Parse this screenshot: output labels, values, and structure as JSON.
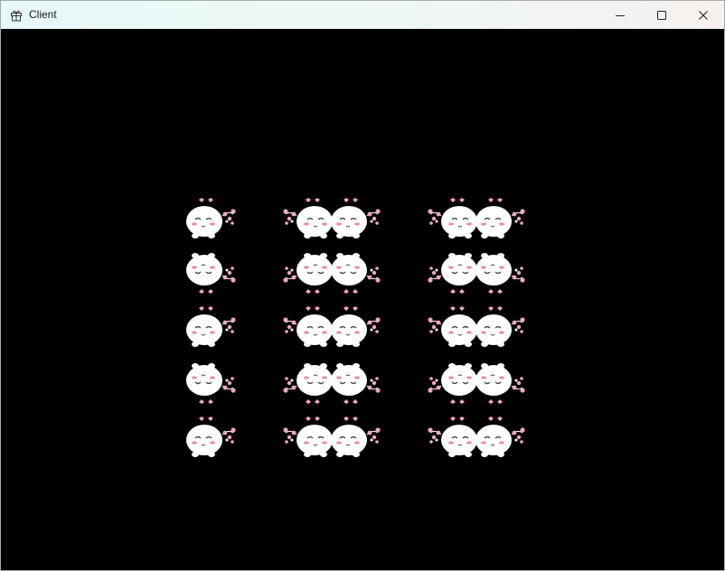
{
  "window": {
    "title": "Client",
    "app_icon": "gift-icon",
    "controls": [
      {
        "name": "minimize-button",
        "icon": "minimize-icon"
      },
      {
        "name": "maximize-button",
        "icon": "maximize-icon"
      },
      {
        "name": "close-button",
        "icon": "close-icon"
      }
    ]
  },
  "canvas": {
    "background": "#000000",
    "sprite": "white-bunny-with-pink-hearts",
    "rows": 5,
    "cols": 5,
    "colors": {
      "body": "#ffffff",
      "heart": "#f4a6bd",
      "blush": "#f08aa6",
      "outline": "#4a4a4a"
    }
  }
}
